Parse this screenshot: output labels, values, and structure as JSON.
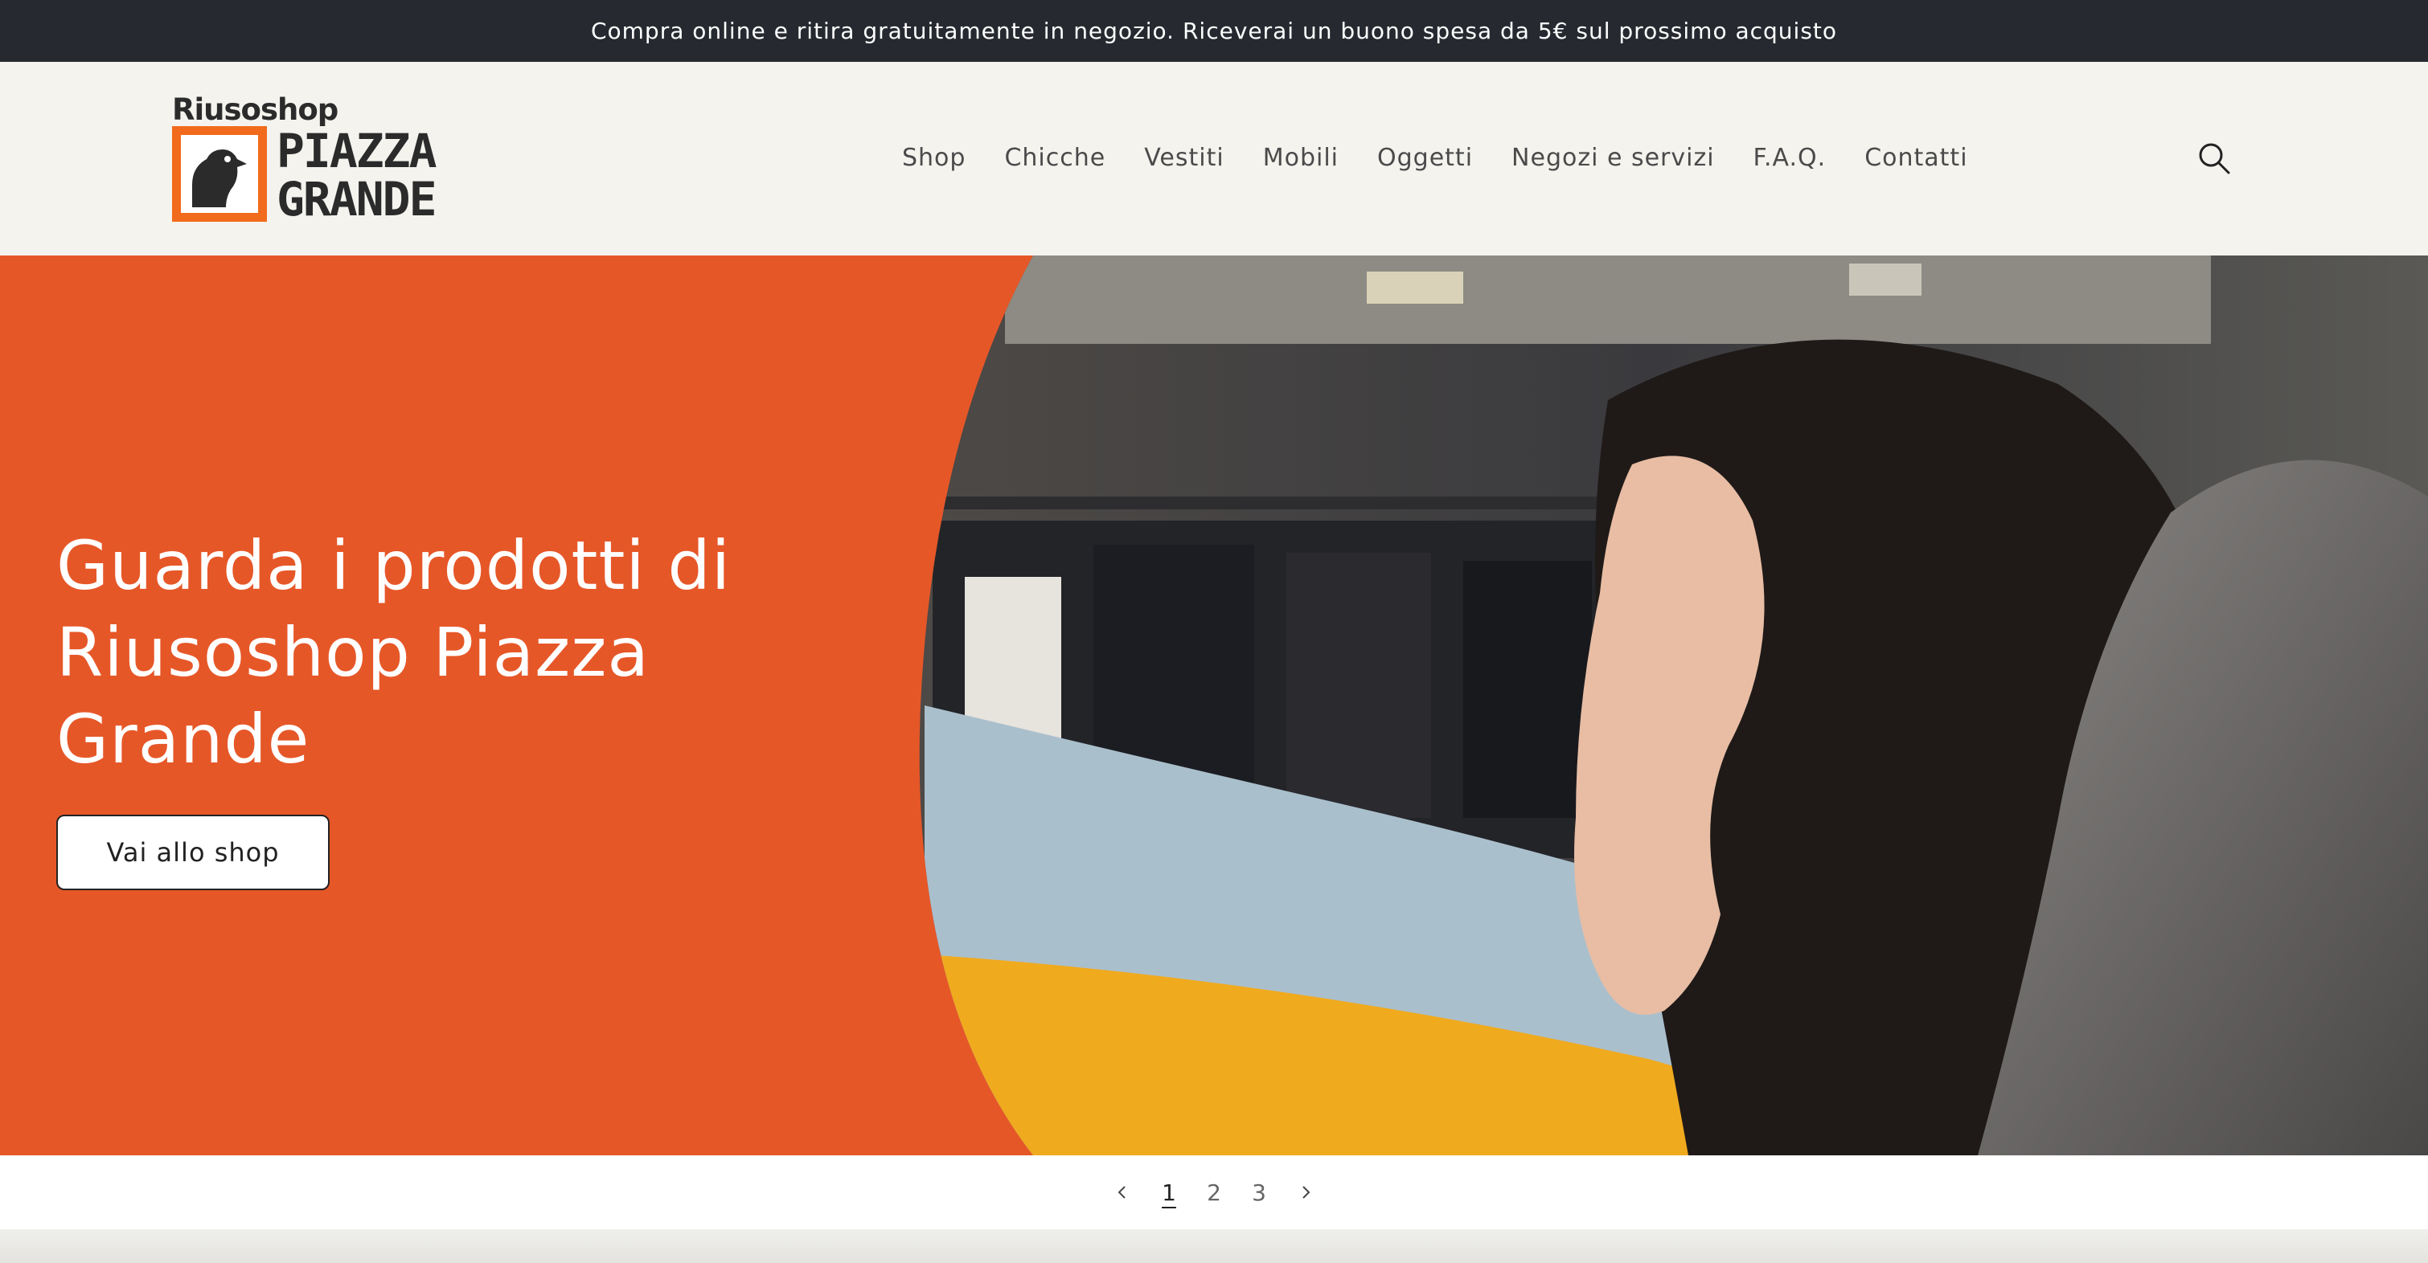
{
  "announcement": {
    "text": "Compra online e ritira gratuitamente in negozio. Riceverai un buono spesa da 5€ sul prossimo acquisto"
  },
  "header": {
    "logo": {
      "top": "Riusoshop",
      "line1": "PIAZZA",
      "line2": "GRANDE"
    },
    "nav": [
      {
        "label": "Shop"
      },
      {
        "label": "Chicche"
      },
      {
        "label": "Vestiti"
      },
      {
        "label": "Mobili"
      },
      {
        "label": "Oggetti"
      },
      {
        "label": "Negozi e servizi"
      },
      {
        "label": "F.A.Q."
      },
      {
        "label": "Contatti"
      }
    ],
    "search_icon": "search-icon"
  },
  "hero": {
    "title": "Guarda i prodotti di Riusoshop Piazza Grande",
    "button_label": "Vai allo shop"
  },
  "slider": {
    "prev_icon": "chevron-left-icon",
    "next_icon": "chevron-right-icon",
    "pages": [
      "1",
      "2",
      "3"
    ],
    "current": "1"
  },
  "colors": {
    "accent_orange": "#e65728",
    "logo_orange": "#f26a1b",
    "announcement_bg": "#262a30",
    "header_bg": "#f4f3ee"
  }
}
